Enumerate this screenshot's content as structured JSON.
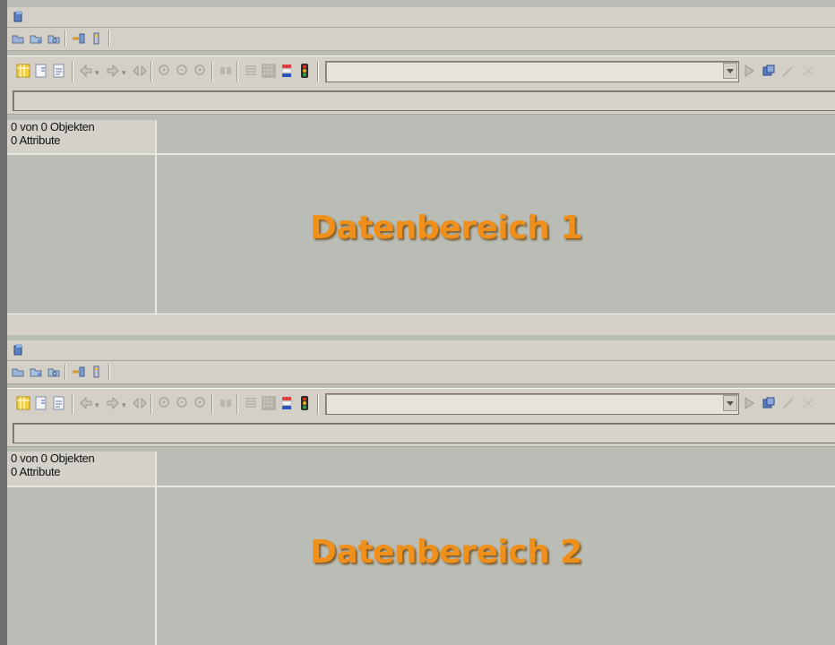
{
  "panels": [
    {
      "object_count": "0 von 0 Objekten",
      "attribute_count": "0 Attribute",
      "area_label": "Datenbereich 1"
    },
    {
      "object_count": "0 von 0 Objekten",
      "attribute_count": "0 Attribute",
      "area_label": "Datenbereich 2"
    }
  ],
  "icons": {
    "toolbar_top": [
      "open-folder-icon",
      "save-icon",
      "search-document-icon",
      "import-icon",
      "properties-icon"
    ],
    "toolbar_main": [
      "grid-view-icon",
      "new-document-icon",
      "edit-document-icon",
      "nav-back-icon",
      "nav-forward-icon",
      "nav-jump-icon",
      "zoom-in-icon",
      "zoom-out-icon",
      "zoom-reset-icon",
      "find-icon",
      "list-icon",
      "table-icon",
      "filter-icon",
      "traffic-light-icon",
      "run-icon",
      "object-icon",
      "wand-icon",
      "close-icon"
    ]
  },
  "colors": {
    "area_label": "#f0901a",
    "panel_background": "#b9bdb6",
    "toolbar_background": "#d4d0c8"
  }
}
